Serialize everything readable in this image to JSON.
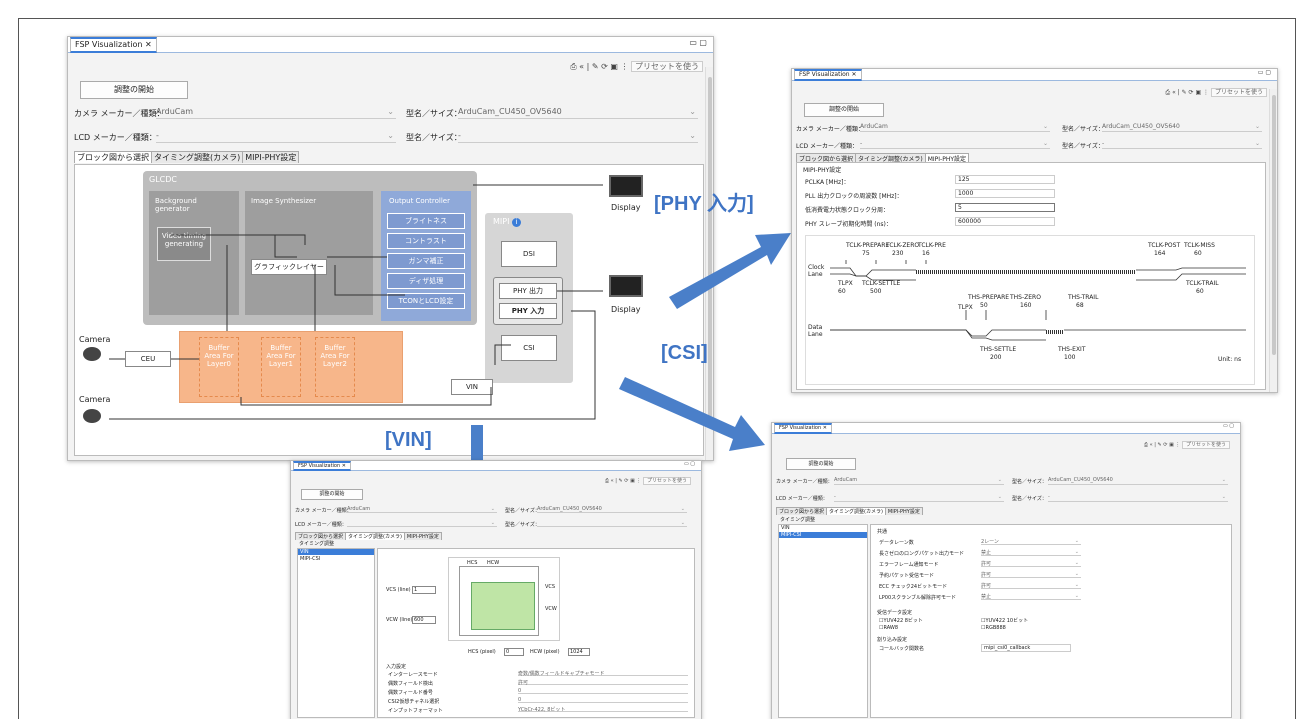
{
  "main_window": {
    "tab_title": "FSP Visualization",
    "preset_label": "プリセットを使う",
    "start_button": "調整の開始",
    "camera_label": "カメラ メーカー／種類：",
    "camera_value": "ArduCam",
    "model_label": "型名／サイズ：",
    "model_value": "ArduCam_CU450_OV5640",
    "lcd_label": "LCD メーカー／種類：",
    "lcd_value": "-",
    "lcd_model_label": "型名／サイズ：",
    "lcd_model_value": "-",
    "tabs": [
      "ブロック図から選択",
      "タイミング調整(カメラ)",
      "MIPI-PHY設定"
    ],
    "diagram": {
      "glcdc": "GLCDC",
      "bg_gen": "Background generator",
      "video_timing": "Video timing generating",
      "image_synth": "Image Synthesizer",
      "graphic_layer": "グラフィックレイヤー",
      "output_controller": "Output Controller",
      "oc_items": [
        "ブライトネス",
        "コントラスト",
        "ガンマ補正",
        "ディザ処理",
        "TCONとLCD設定"
      ],
      "mipi": "MIPI",
      "dsi": "DSI",
      "phy_out": "PHY 出力",
      "phy_in": "PHY 入力",
      "csi": "CSI",
      "vin": "VIN",
      "ceu": "CEU",
      "camera1": "Camera",
      "camera2": "Camera",
      "display1": "Display",
      "display2": "Display",
      "buffers": [
        "Buffer Area For Layer0",
        "Buffer Area For Layer1",
        "Buffer Area For Layer2"
      ]
    }
  },
  "callouts": {
    "phy": "[PHY 入力]",
    "csi": "[CSI]",
    "vin": "[VIN]"
  },
  "phy_window": {
    "tab_title": "FSP Visualization",
    "preset_label": "プリセットを使う",
    "start_button": "調整の開始",
    "camera_label": "カメラ メーカー／種類：",
    "camera_value": "ArduCam",
    "model_label": "型名／サイズ：",
    "model_value": "ArduCam_CU450_OV5640",
    "lcd_label": "LCD メーカー／種類：",
    "lcd_value": "-",
    "lcd_model_label": "型名／サイズ：",
    "lcd_model_value": "-",
    "tabs": [
      "ブロック図から選択",
      "タイミング調整(カメラ)",
      "MIPI-PHY設定"
    ],
    "section": "MIPI-PHY設定",
    "fields": [
      {
        "label": "PCLKA [MHz]：",
        "value": "125"
      },
      {
        "label": "PLL 出力クロックの周波数 [MHz]：",
        "value": "1000"
      },
      {
        "label": "低消費電力状態クロック分周：",
        "value": "5"
      },
      {
        "label": "PHY スレーブ初期化時間 (ns)：",
        "value": "600000"
      }
    ],
    "timing": {
      "tclk_prepare": "TCLK-PREPARE",
      "tclk_prepare_v": "75",
      "tclk_zero": "TCLK-ZERO",
      "tclk_zero_v": "230",
      "tclk_pre": "TCLK-PRE",
      "tclk_pre_v": "16",
      "tclk_post": "TCLK-POST",
      "tclk_post_v": "164",
      "tclk_miss": "TCLK-MISS",
      "tclk_miss_v": "60",
      "tlpx": "TLPX",
      "tlpx_v": "60",
      "tclk_settle": "TCLK-SETTLE",
      "tclk_settle_v": "500",
      "tclk_trail": "TCLK-TRAIL",
      "tclk_trail_v": "60",
      "clock_lane": "Clock Lane",
      "data_lane": "Data Lane",
      "tlpx2": "TLPX",
      "ths_prepare": "THS-PREPARE",
      "ths_prepare_v": "50",
      "ths_zero": "THS-ZERO",
      "ths_zero_v": "160",
      "ths_trail": "THS-TRAIL",
      "ths_trail_v": "68",
      "ths_settle": "THS-SETTLE",
      "ths_settle_v": "200",
      "ths_exit": "THS-EXIT",
      "ths_exit_v": "100",
      "unit": "Unit: ns"
    }
  },
  "vin_window": {
    "tab_title": "FSP Visualization",
    "preset_label": "プリセットを使う",
    "start_button": "調整の開始",
    "camera_label": "カメラ メーカー／種類：",
    "camera_value": "ArduCam",
    "model_label": "型名／サイズ：",
    "model_value": "ArduCam_CU450_OV5640",
    "lcd_label": "LCD メーカー／種類：",
    "lcd_value": "",
    "lcd_model_label": "型名／サイズ：",
    "lcd_model_value": "",
    "tabs": [
      "ブロック図から選択",
      "タイミング調整(カメラ)",
      "MIPI-PHY設定"
    ],
    "sub_tab": "タイミング調整",
    "list": [
      "VIN",
      "MIPI-CSI"
    ],
    "vcs_label": "VCS (line)",
    "vcs_value": "1",
    "vcw_label": "VCW (line)",
    "vcw_value": "600",
    "hcs_label": "HCS (pixel)",
    "hcs_value": "0",
    "hcw_label": "HCW (pixel)",
    "hcw_value": "1024",
    "diag_hcs": "HCS",
    "diag_hcw": "HCW",
    "diag_vcs": "VCS",
    "diag_vcw": "VCW",
    "section": "入力設定",
    "rows": [
      {
        "label": "インターレースモード",
        "value": "奇数/偶数フィールドキャプチャモード"
      },
      {
        "label": "偶数フィールド検出",
        "value": "許可"
      },
      {
        "label": "偶数フィールド番号",
        "value": "0"
      },
      {
        "label": "CSI2仮想チャネル選択",
        "value": "0"
      },
      {
        "label": "インプットフォーマット",
        "value": "YCbCr-422, 8ビット"
      }
    ]
  },
  "csi_window": {
    "tab_title": "FSP Visualization",
    "preset_label": "プリセットを使う",
    "start_button": "調整の開始",
    "camera_label": "カメラ メーカー／種類：",
    "camera_value": "ArduCam",
    "model_label": "型名／サイズ：",
    "model_value": "ArduCam_CU450_OV5640",
    "lcd_label": "LCD メーカー／種類：",
    "lcd_value": "-",
    "lcd_model_label": "型名／サイズ：",
    "lcd_model_value": "-",
    "tabs": [
      "ブロック図から選択",
      "タイミング調整(カメラ)",
      "MIPI-PHY設定"
    ],
    "sub_tab": "タイミング調整",
    "list": [
      "VIN",
      "MIPI-CSI"
    ],
    "common": "共通",
    "rows": [
      {
        "label": "データレーン数",
        "value": "2レーン"
      },
      {
        "label": "長さゼロのロングパケット出力モード",
        "value": "禁止"
      },
      {
        "label": "エラーフレーム通知モード",
        "value": "許可"
      },
      {
        "label": "予約パケット受信モード",
        "value": "許可"
      },
      {
        "label": "ECC チェック24ビットモード",
        "value": "許可"
      },
      {
        "label": "LP00スクランブル解除許可モード",
        "value": "禁止"
      }
    ],
    "recv_section": "受信データ設定",
    "recv": [
      "YUV422 8ビット",
      "YUV422 10ビット",
      "RAW8",
      "RGB888"
    ],
    "irq_section": "割り込み設定",
    "callback_label": "コールバック関数名",
    "callback_value": "mipi_csi0_callback"
  },
  "colors": {
    "arrow": "#4a7fc9",
    "callout": "#3f74c4",
    "buffer": "#f7b68a",
    "gray_block": "#9e9e9e",
    "output_controller": "#8fa9d9"
  }
}
